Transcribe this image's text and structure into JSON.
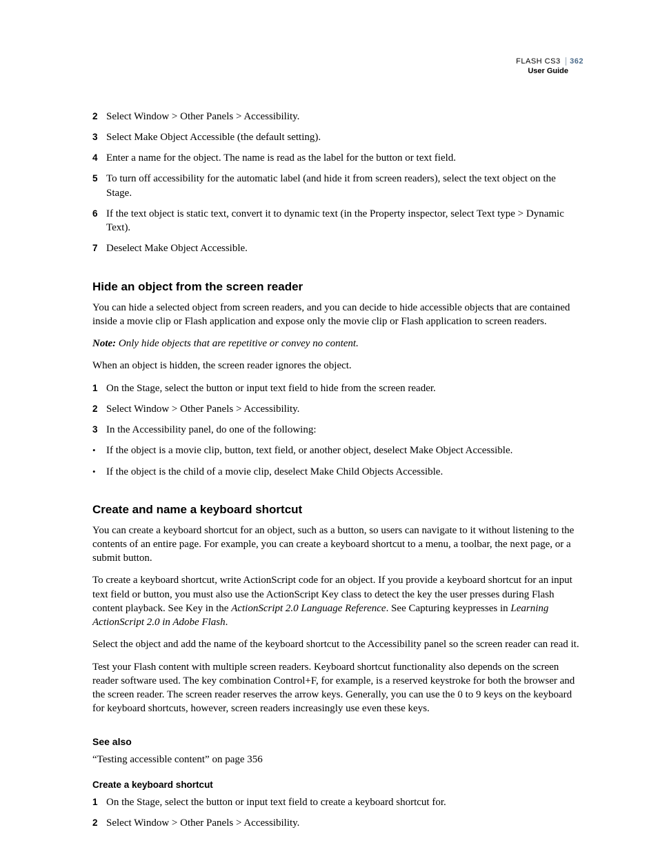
{
  "header": {
    "product": "FLASH CS3",
    "pagenum": "362",
    "guide": "User Guide"
  },
  "steps1": {
    "s2": "Select Window > Other Panels > Accessibility.",
    "s3": "Select Make Object Accessible (the default setting).",
    "s4": "Enter a name for the object. The name is read as the label for the button or text field.",
    "s5": "To turn off accessibility for the automatic label (and hide it from screen readers), select the text object on the Stage.",
    "s6": "If the text object is static text, convert it to dynamic text (in the Property inspector, select Text type > Dynamic Text).",
    "s7": "Deselect Make Object Accessible."
  },
  "sec1": {
    "title": "Hide an object from the screen reader",
    "p1": "You can hide a selected object from screen readers, and you can decide to hide accessible objects that are contained inside a movie clip or Flash application and expose only the movie clip or Flash application to screen readers.",
    "noteLabel": "Note:",
    "noteBody": " Only hide objects that are repetitive or convey no content.",
    "p2": "When an object is hidden, the screen reader ignores the object.",
    "st1": "On the Stage, select the button or input text field to hide from the screen reader.",
    "st2": "Select Window > Other Panels > Accessibility.",
    "st3": "In the Accessibility panel, do one of the following:",
    "b1": "If the object is a movie clip, button, text field, or another object, deselect Make Object Accessible.",
    "b2": "If the object is the child of a movie clip, deselect Make Child Objects Accessible."
  },
  "sec2": {
    "title": "Create and name a keyboard shortcut",
    "p1": "You can create a keyboard shortcut for an object, such as a button, so users can navigate to it without listening to the contents of an entire page. For example, you can create a keyboard shortcut to a menu, a toolbar, the next page, or a submit button.",
    "p2a": "To create a keyboard shortcut, write ActionScript code for an object. If you provide a keyboard shortcut for an input text field or button, you must also use the ActionScript Key class to detect the key the user presses during Flash content playback. See Key in the ",
    "p2i1": "ActionScript 2.0 Language Reference",
    "p2b": ". See Capturing keypresses in ",
    "p2i2": "Learning ActionScript 2.0 in Adobe Flash",
    "p2c": ".",
    "p3": "Select the object and add the name of the keyboard shortcut to the Accessibility panel so the screen reader can read it.",
    "p4": "Test your Flash content with multiple screen readers. Keyboard shortcut functionality also depends on the screen reader software used. The key combination Control+F, for example, is a reserved keystroke for both the browser and the screen reader. The screen reader reserves the arrow keys. Generally, you can use the 0 to 9 keys on the keyboard for keyboard shortcuts, however, screen readers increasingly use even these keys."
  },
  "seealso": {
    "title": "See also",
    "link": "“Testing accessible content” on page 356"
  },
  "sec3": {
    "title": "Create a keyboard shortcut",
    "st1": "On the Stage, select the button or input text field to create a keyboard shortcut for.",
    "st2": "Select Window > Other Panels > Accessibility."
  }
}
